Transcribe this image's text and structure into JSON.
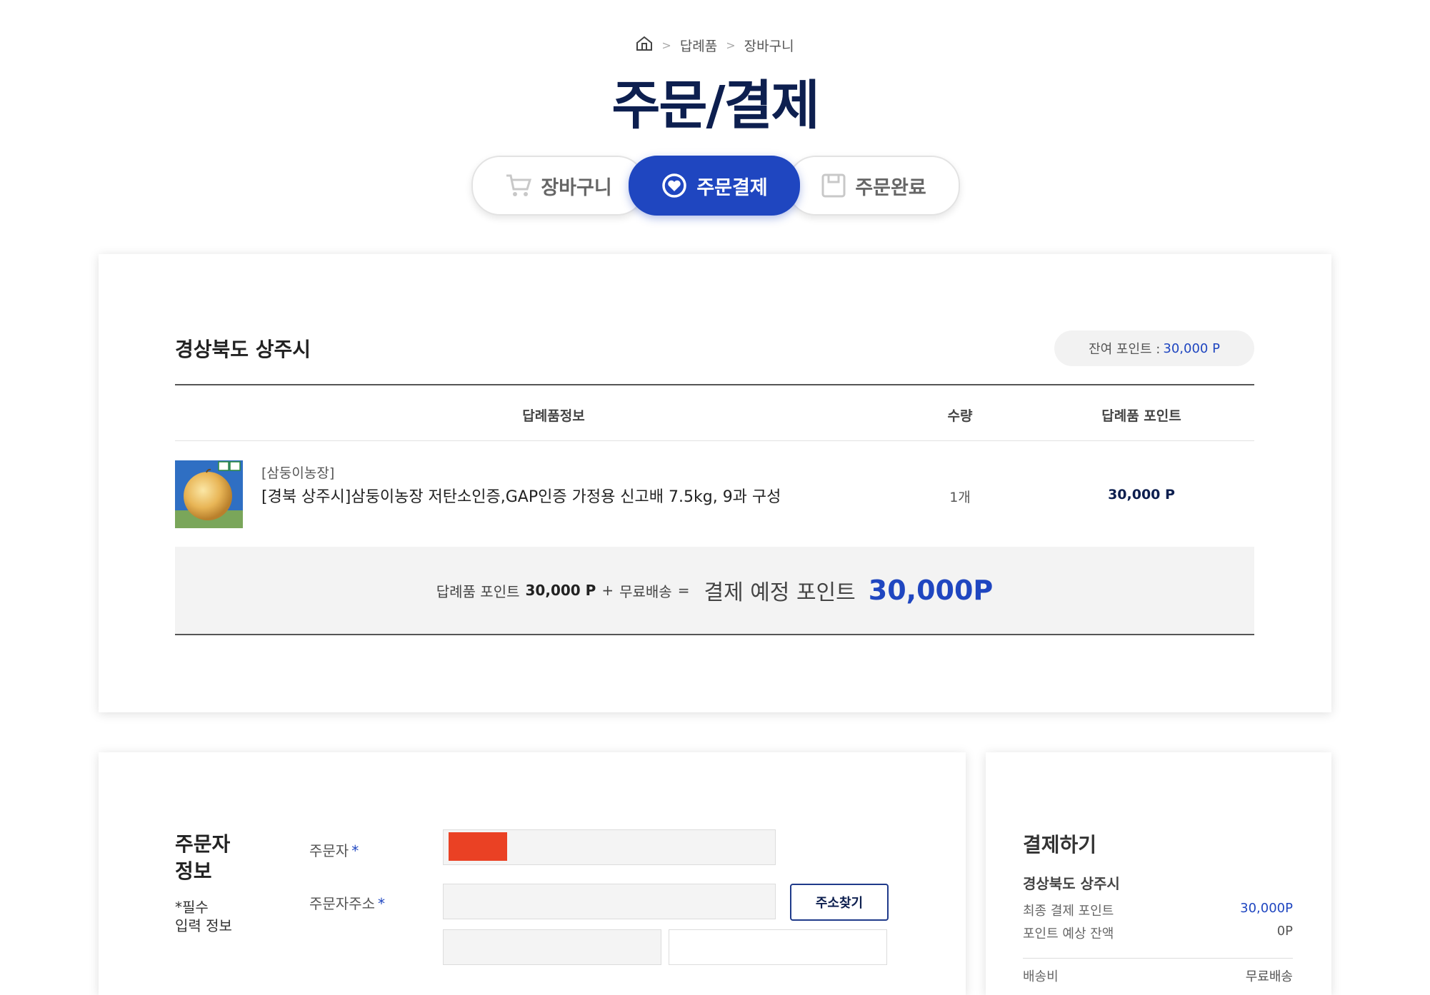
{
  "breadcrumb": {
    "home": "home",
    "items": [
      "답례품",
      "장바구니"
    ]
  },
  "page_title": "주문/결제",
  "steps": [
    {
      "label": "장바구니",
      "icon": "cart-icon",
      "active": false
    },
    {
      "label": "주문결제",
      "icon": "heart-circle-icon",
      "active": true
    },
    {
      "label": "주문완료",
      "icon": "box-icon",
      "active": false
    }
  ],
  "cart": {
    "region": "경상북도 상주시",
    "remaining_label": "잔여 포인트 :",
    "remaining_value": "30,000 P",
    "headers": {
      "info": "답례품정보",
      "qty": "수량",
      "point": "답례품 포인트"
    },
    "item": {
      "seller": "[삼둥이농장]",
      "name": "[경북 상주시]삼둥이농장 저탄소인증,GAP인증 가정용 신고배 7.5kg, 9과 구성",
      "qty": "1개",
      "point": "30,000 P"
    },
    "summary": {
      "gift_label": "답례품 포인트",
      "gift_value": "30,000 P",
      "plus": "+",
      "shipping": "무료배송",
      "equals": "=",
      "total_label": "결제 예정 포인트",
      "total_value": "30,000P"
    }
  },
  "orderer": {
    "section_title": "주문자\n정보",
    "required_note": "*필수\n  입력 정보",
    "name_label": "주문자",
    "address_label": "주문자주소",
    "required_mark": "*",
    "address_button": "주소찾기"
  },
  "payment": {
    "title": "결제하기",
    "region": "경상북도 상주시",
    "final_label": "최종 결제 포인트",
    "final_value": "30,000P",
    "balance_label": "포인트 예상 잔액",
    "balance_value": "0P",
    "shipping_label": "배송비",
    "shipping_value": "무료배송"
  },
  "colors": {
    "primary": "#1f46c0",
    "navy": "#0d1f4f",
    "redact": "#ea4124"
  }
}
